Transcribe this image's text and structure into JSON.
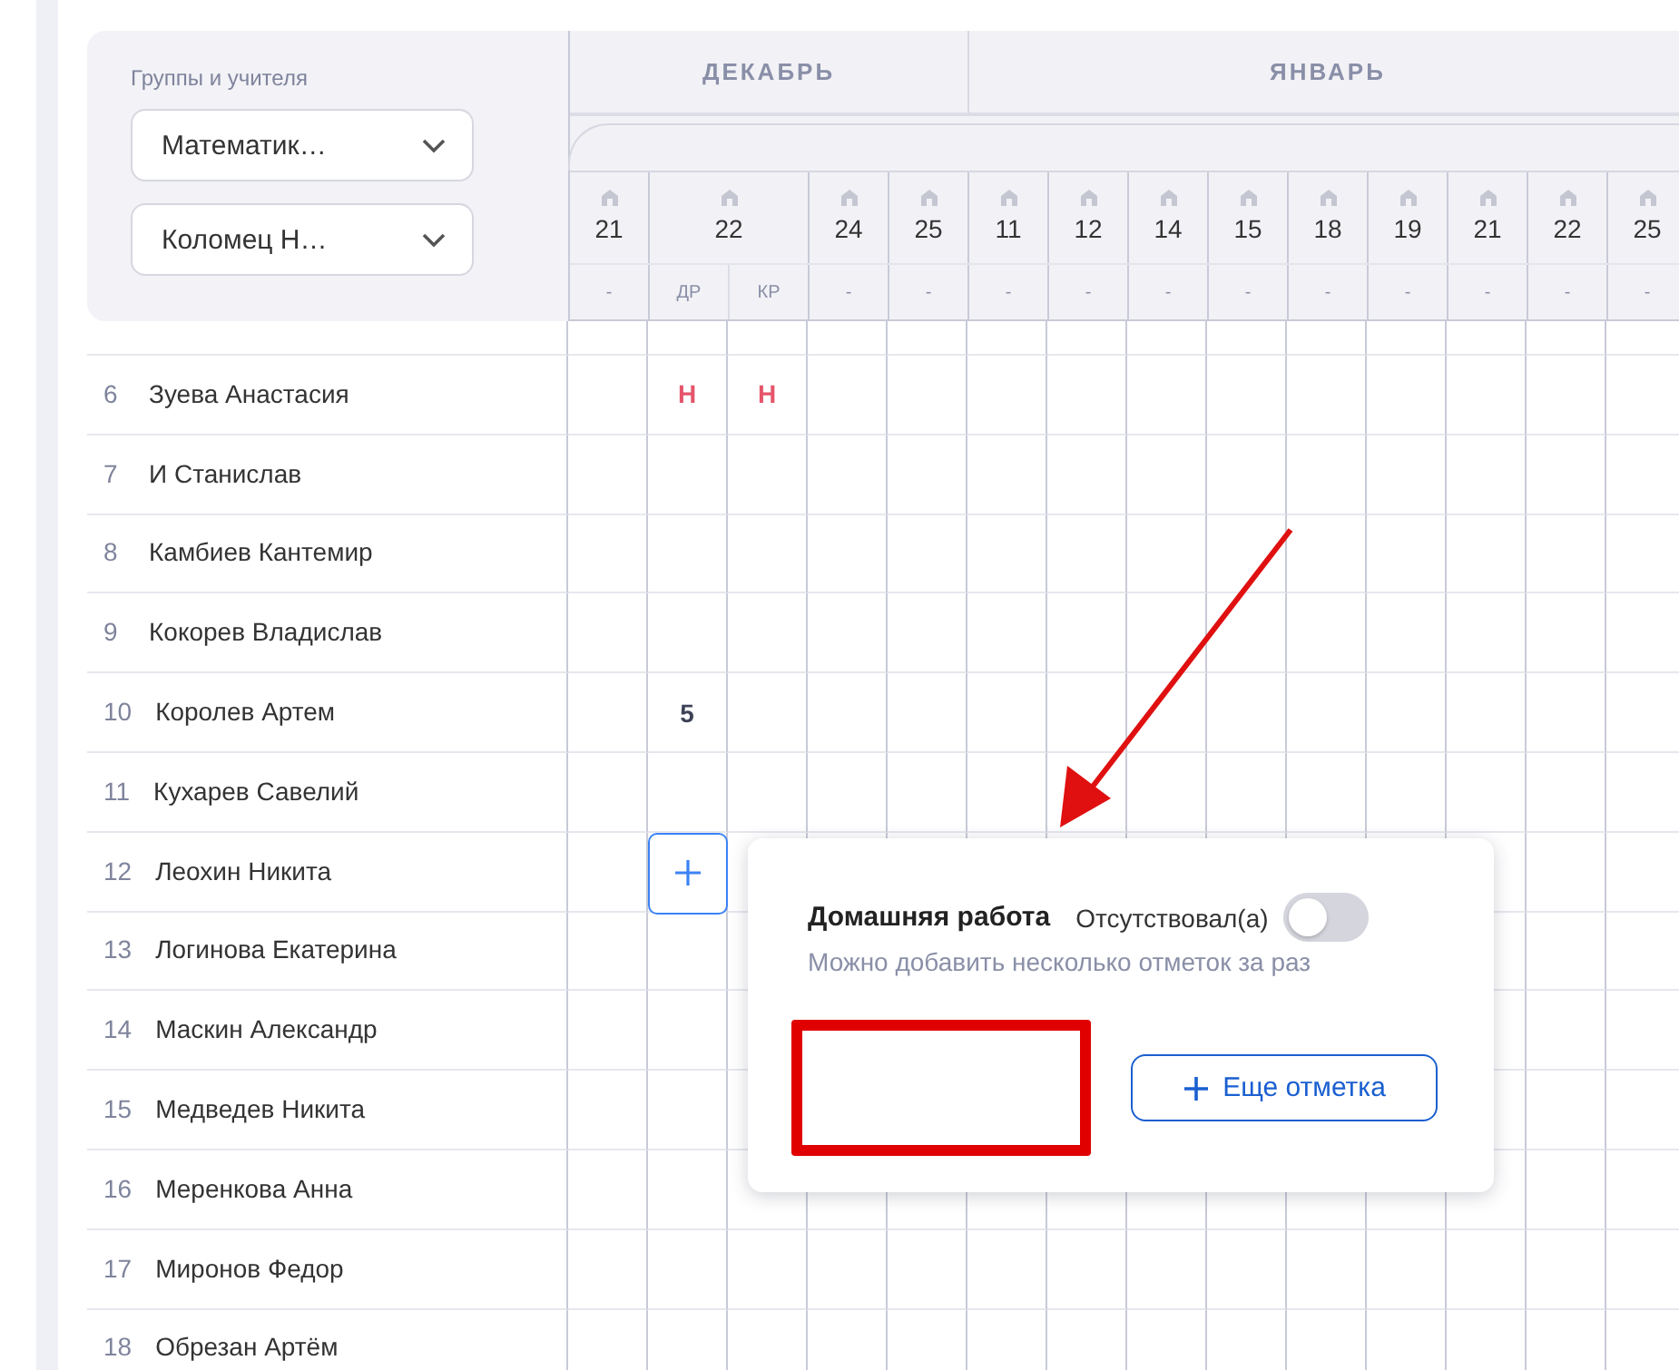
{
  "filters": {
    "label": "Группы и учителя",
    "selects": [
      {
        "value": "Математик…"
      },
      {
        "value": "Коломец Н…"
      }
    ]
  },
  "months": [
    {
      "name": "ДЕКАБРЬ",
      "dates": [
        {
          "day": "21",
          "types": [
            "-"
          ]
        },
        {
          "day": "22",
          "types": [
            "ДР",
            "КР"
          ]
        },
        {
          "day": "24",
          "types": [
            "-"
          ]
        },
        {
          "day": "25",
          "types": [
            "-"
          ]
        }
      ]
    },
    {
      "name": "ЯНВАРЬ",
      "dates": [
        {
          "day": "11",
          "types": [
            "-"
          ]
        },
        {
          "day": "12",
          "types": [
            "-"
          ]
        },
        {
          "day": "14",
          "types": [
            "-"
          ]
        },
        {
          "day": "15",
          "types": [
            "-"
          ]
        },
        {
          "day": "18",
          "types": [
            "-"
          ]
        },
        {
          "day": "19",
          "types": [
            "-"
          ]
        },
        {
          "day": "21",
          "types": [
            "-"
          ]
        },
        {
          "day": "22",
          "types": [
            "-"
          ]
        },
        {
          "day": "25",
          "types": [
            "-"
          ]
        }
      ]
    }
  ],
  "students": [
    {
      "number": "6",
      "name": "Зуева Анастасия",
      "editing": false,
      "cells": [
        {},
        {
          "mark": "Н",
          "kind": "absent"
        },
        {
          "mark": "Н",
          "kind": "absent"
        }
      ]
    },
    {
      "number": "7",
      "name": "И Станислав",
      "editing": false
    },
    {
      "number": "8",
      "name": "Камбиев Кантемир",
      "editing": false
    },
    {
      "number": "9",
      "name": "Кокорев Владислав",
      "editing": false
    },
    {
      "number": "10",
      "name": "Королев Артем",
      "editing": false,
      "cells": [
        {},
        {
          "mark": "5",
          "kind": "grade"
        }
      ]
    },
    {
      "number": "11",
      "name": "Кухарев Савелий",
      "editing": false
    },
    {
      "number": "12",
      "name": "Леохин Никита",
      "editing": true
    },
    {
      "number": "13",
      "name": "Логинова Екатерина",
      "editing": false
    },
    {
      "number": "14",
      "name": "Маскин Александр",
      "editing": false
    },
    {
      "number": "15",
      "name": "Медведев Никита",
      "editing": false
    },
    {
      "number": "16",
      "name": "Меренкова Анна",
      "editing": false
    },
    {
      "number": "17",
      "name": "Миронов Федор",
      "editing": false
    },
    {
      "number": "18",
      "name": "Обрезан Артём",
      "editing": false
    }
  ],
  "popup": {
    "title": "Домашняя работа",
    "absent_label": "Отсутствовал(а)",
    "absent": false,
    "hint": "Можно добавить несколько отметок за раз",
    "add_label": "Еще отметка"
  }
}
